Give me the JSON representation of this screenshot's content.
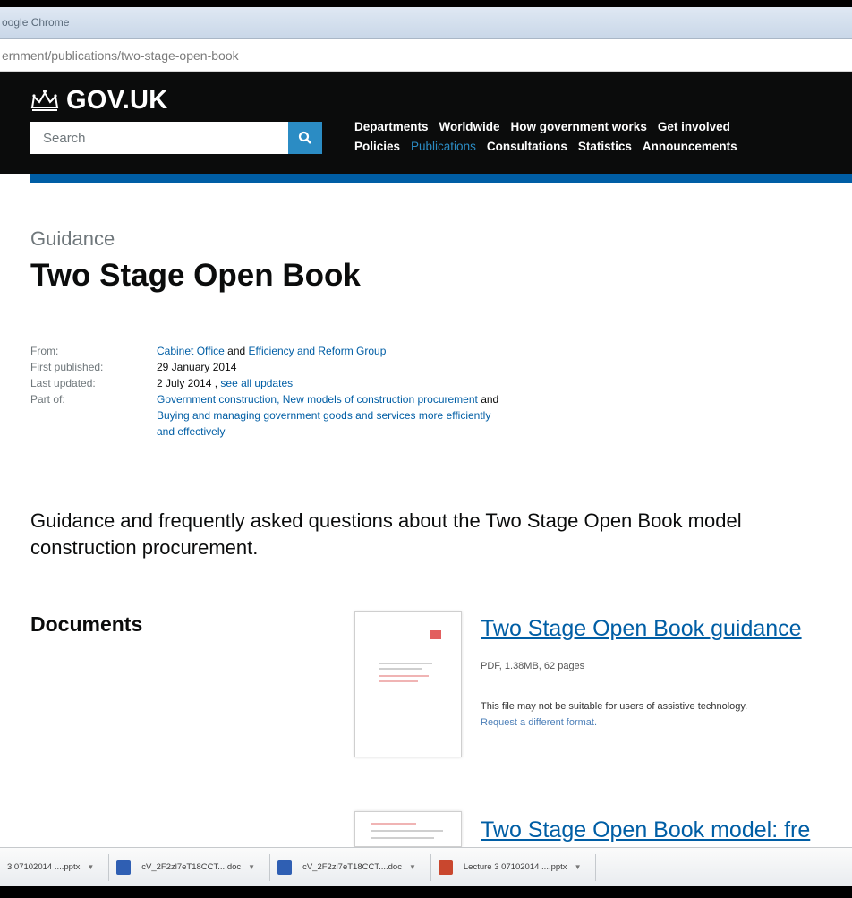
{
  "browser": {
    "window_title": "oogle Chrome",
    "url": "ernment/publications/two-stage-open-book"
  },
  "header": {
    "logo_text": "GOV.UK",
    "search_placeholder": "Search",
    "nav_row1": [
      "Departments",
      "Worldwide",
      "How government works",
      "Get involved"
    ],
    "nav_row2": [
      "Policies",
      "Publications",
      "Consultations",
      "Statistics",
      "Announcements"
    ],
    "active_nav": "Publications"
  },
  "page": {
    "document_type": "Guidance",
    "title": "Two Stage Open Book",
    "meta": {
      "from_label": "From:",
      "from_org1": "Cabinet Office",
      "from_and": "and",
      "from_org2": "Efficiency and Reform Group",
      "first_published_label": "First published:",
      "first_published": "29 January 2014",
      "last_updated_label": "Last updated:",
      "last_updated": "2 July 2014 ,",
      "see_all_updates": "see all updates",
      "part_of_label": "Part of:",
      "part_of_1": "Government construction,",
      "part_of_2": "New models of construction procurement",
      "part_of_and": "and",
      "part_of_3a": "Buying and managing government goods and services more efficiently",
      "part_of_3b": "and effectively"
    },
    "summary_line1": "Guidance and frequently asked questions about the Two Stage Open Book model",
    "summary_line2": "construction procurement.",
    "documents_heading": "Documents",
    "attachments": [
      {
        "title": "Two Stage Open Book guidance",
        "meta": "PDF, 1.38MB, 62 pages",
        "note_line1": "This file may not be suitable for users of assistive technology.",
        "note_link": "Request a different format."
      },
      {
        "title": "Two Stage Open Book model: fre"
      }
    ]
  },
  "downloads_bar": {
    "items": [
      {
        "name": "3 07102014 ....pptx",
        "type": "pptx"
      },
      {
        "name": "cV_2F2zl7eT18CCT....doc",
        "type": "doc"
      },
      {
        "name": "cV_2F2zl7eT18CCT....doc",
        "type": "doc"
      },
      {
        "name": "Lecture 3 07102014 ....pptx",
        "type": "pptx"
      }
    ]
  },
  "colors": {
    "header_bg": "#0b0c0c",
    "link": "#005ea5",
    "search_button": "#2b8cc4",
    "header_bar": "#005ea5"
  }
}
